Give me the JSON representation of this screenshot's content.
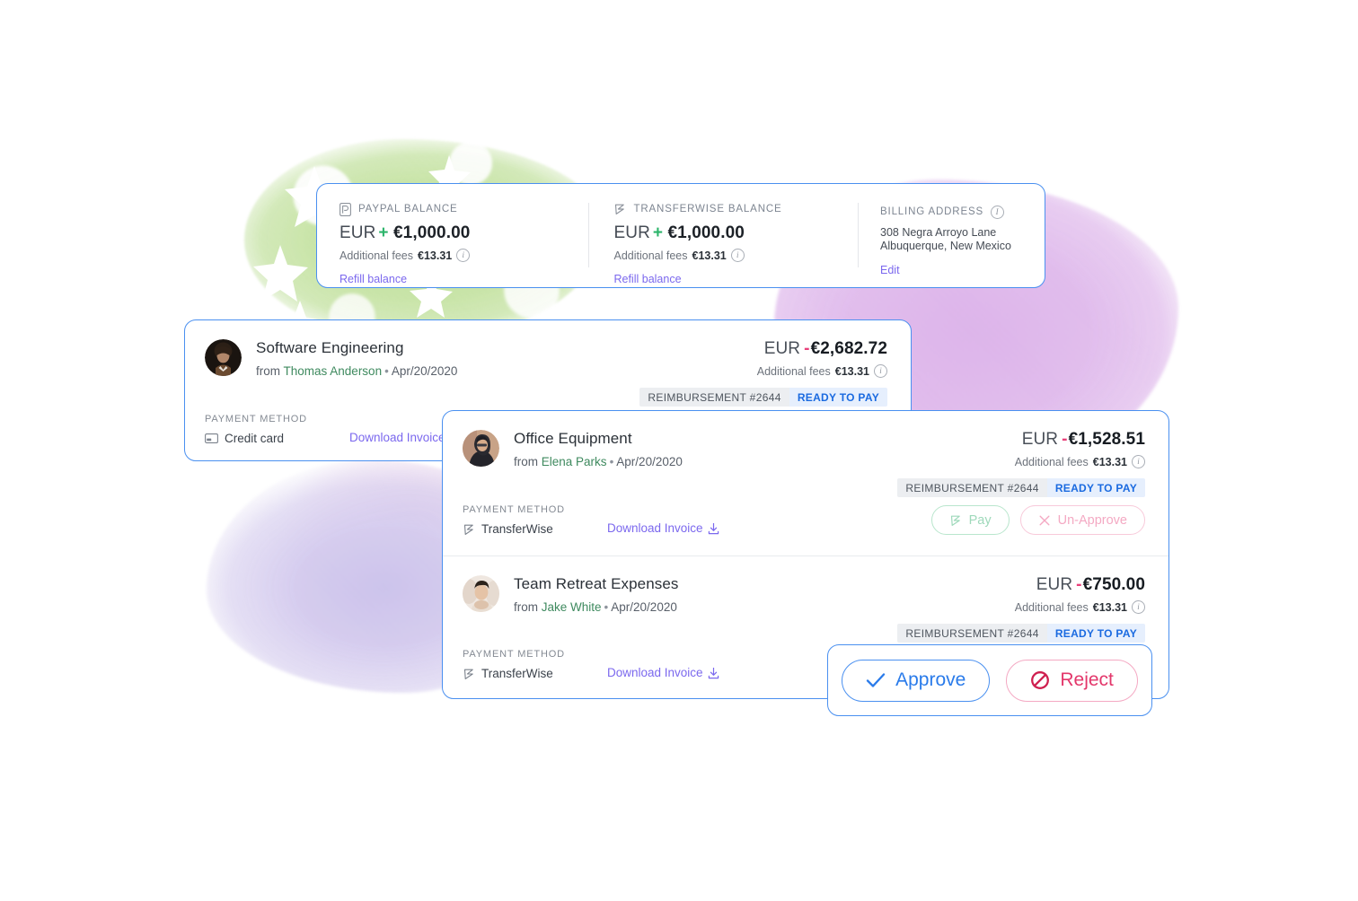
{
  "balance_card": {
    "columns": [
      {
        "icon": "paypal-icon",
        "label": "PAYPAL BALANCE",
        "currency": "EUR",
        "sign": "+",
        "amount": "€1,000.00",
        "fees_label": "Additional fees",
        "fees_value": "€13.31",
        "link": "Refill balance"
      },
      {
        "icon": "transferwise-icon",
        "label": "TRANSFERWISE BALANCE",
        "currency": "EUR",
        "sign": "+",
        "amount": "€1,000.00",
        "fees_label": "Additional fees",
        "fees_value": "€13.31",
        "link": "Refill balance"
      }
    ],
    "billing": {
      "label": "BILLING ADDRESS",
      "line1": "308 Negra Arroyo Lane",
      "line2": "Albuquerque, New Mexico",
      "edit": "Edit"
    }
  },
  "expenses": [
    {
      "title": "Software Engineering",
      "from_prefix": "from",
      "person": "Thomas Anderson",
      "separator": "•",
      "date": "Apr/20/2020",
      "currency": "EUR",
      "sign": "-",
      "amount": "€2,682.72",
      "fees_label": "Additional fees",
      "fees_value": "€13.31",
      "badge_reference": "REIMBURSEMENT #2644",
      "badge_status": "READY TO PAY",
      "payment_method_label": "PAYMENT METHOD",
      "payment_method": "Credit card",
      "payment_method_icon": "credit-card-icon",
      "download_label": "Download Invoice",
      "actions": []
    },
    {
      "title": "Office Equipment",
      "from_prefix": "from",
      "person": "Elena Parks",
      "separator": "•",
      "date": "Apr/20/2020",
      "currency": "EUR",
      "sign": "-",
      "amount": "€1,528.51",
      "fees_label": "Additional fees",
      "fees_value": "€13.31",
      "badge_reference": "REIMBURSEMENT #2644",
      "badge_status": "READY TO PAY",
      "payment_method_label": "PAYMENT METHOD",
      "payment_method": "TransferWise",
      "payment_method_icon": "transferwise-icon",
      "download_label": "Download Invoice",
      "actions": [
        {
          "label": "Pay",
          "icon": "transferwise-icon",
          "style": "pay"
        },
        {
          "label": "Un-Approve",
          "icon": "close-x-icon",
          "style": "unapprove"
        }
      ]
    },
    {
      "title": "Team Retreat Expenses",
      "from_prefix": "from",
      "person": "Jake White",
      "separator": "•",
      "date": "Apr/20/2020",
      "currency": "EUR",
      "sign": "-",
      "amount": "€750.00",
      "fees_label": "Additional fees",
      "fees_value": "€13.31",
      "badge_reference": "REIMBURSEMENT #2644",
      "badge_status": "READY TO PAY",
      "payment_method_label": "PAYMENT METHOD",
      "payment_method": "TransferWise",
      "payment_method_icon": "transferwise-icon",
      "download_label": "Download Invoice",
      "actions": []
    }
  ],
  "approve_panel": {
    "approve_label": "Approve",
    "approve_icon": "check-icon",
    "reject_label": "Reject",
    "reject_icon": "block-icon"
  },
  "colors": {
    "card_border": "#4a90f0",
    "link": "#7b68ee",
    "positive": "#2db46b",
    "negative": "#e8407a",
    "person": "#3f8a5f",
    "status": "#1a6ae0",
    "reject": "#e3376b",
    "approve": "#2a7bea",
    "blob_green": "#bddf96",
    "blob_purple": "#d9aae8",
    "blob_lilac": "#cec4ec"
  }
}
